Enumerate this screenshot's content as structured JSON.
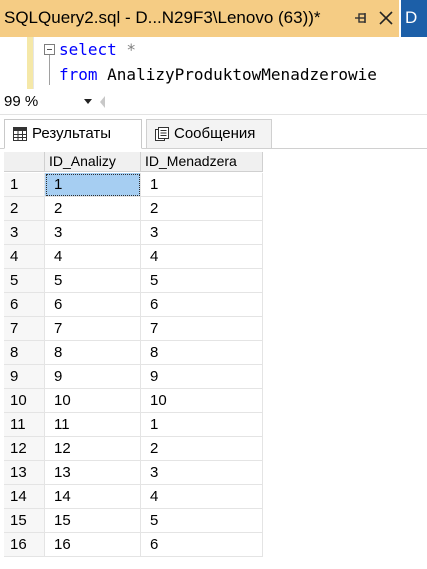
{
  "tab": {
    "title": "SQLQuery2.sql - D...N29F3\\Lenovo (63))*",
    "pin_symbol": "⊣",
    "next_tab_fragment": "D"
  },
  "editor": {
    "line1": {
      "keyword": "select",
      "rest": " *"
    },
    "line2": {
      "keyword": "from",
      "rest": " AnalizyProduktowMenadzerowie"
    }
  },
  "zoom": {
    "value": "99 %"
  },
  "results_tabs": [
    {
      "label": "Результаты",
      "icon": "grid-icon",
      "active": true
    },
    {
      "label": "Сообщения",
      "icon": "messages-icon",
      "active": false
    }
  ],
  "grid": {
    "columns": [
      "ID_Analizy",
      "ID_Menadzera"
    ],
    "rows": [
      {
        "n": "1",
        "a": "1",
        "m": "1"
      },
      {
        "n": "2",
        "a": "2",
        "m": "2"
      },
      {
        "n": "3",
        "a": "3",
        "m": "3"
      },
      {
        "n": "4",
        "a": "4",
        "m": "4"
      },
      {
        "n": "5",
        "a": "5",
        "m": "5"
      },
      {
        "n": "6",
        "a": "6",
        "m": "6"
      },
      {
        "n": "7",
        "a": "7",
        "m": "7"
      },
      {
        "n": "8",
        "a": "8",
        "m": "8"
      },
      {
        "n": "9",
        "a": "9",
        "m": "9"
      },
      {
        "n": "10",
        "a": "10",
        "m": "10"
      },
      {
        "n": "11",
        "a": "11",
        "m": "1"
      },
      {
        "n": "12",
        "a": "12",
        "m": "2"
      },
      {
        "n": "13",
        "a": "13",
        "m": "3"
      },
      {
        "n": "14",
        "a": "14",
        "m": "4"
      },
      {
        "n": "15",
        "a": "15",
        "m": "5"
      },
      {
        "n": "16",
        "a": "16",
        "m": "6"
      }
    ]
  },
  "colors": {
    "active_tab": "#f5cc84",
    "selection": "#a6cef2",
    "keyword": "#0000ff"
  }
}
